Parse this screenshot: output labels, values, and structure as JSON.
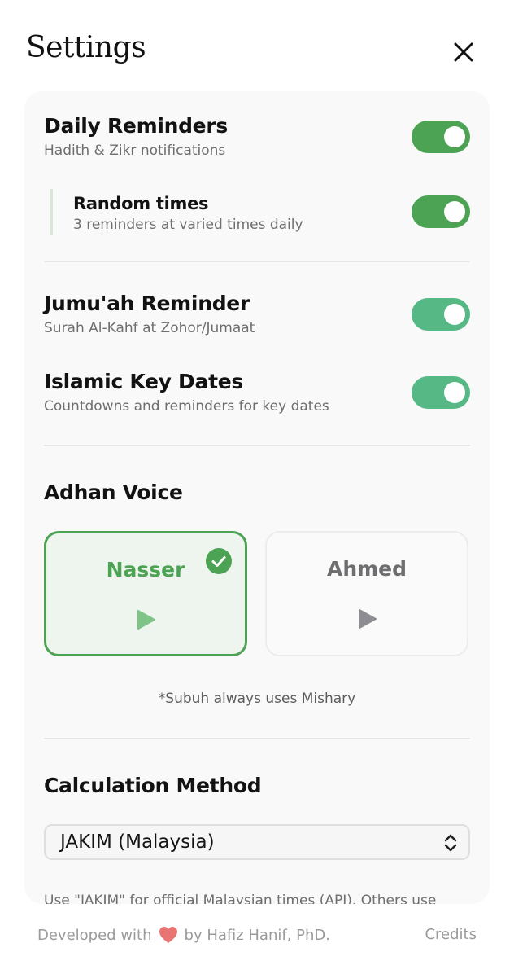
{
  "header": {
    "title": "Settings"
  },
  "reminders": {
    "daily": {
      "title": "Daily Reminders",
      "subtitle": "Hadith & Zikr notifications",
      "enabled": true
    },
    "random": {
      "title": "Random times",
      "subtitle": "3 reminders at varied times daily",
      "enabled": true
    },
    "jumuah": {
      "title": "Jumu'ah Reminder",
      "subtitle": "Surah Al-Kahf at Zohor/Jumaat",
      "enabled": true
    },
    "key_dates": {
      "title": "Islamic Key Dates",
      "subtitle": "Countdowns and reminders for key dates",
      "enabled": true
    }
  },
  "adhan": {
    "title": "Adhan Voice",
    "voices": [
      {
        "name": "Nasser",
        "selected": true
      },
      {
        "name": "Ahmed",
        "selected": false
      }
    ],
    "note": "*Subuh always uses Mishary"
  },
  "calculation": {
    "title": "Calculation Method",
    "selected": "JAKIM (Malaysia)",
    "help": "Use \"JAKIM\" for official Malaysian times (API). Others use"
  },
  "footer": {
    "developed_prefix": "Developed with",
    "developed_suffix": "by Hafiz Hanif, PhD.",
    "credits": "Credits"
  },
  "colors": {
    "toggle_dark_green": "#4ca353",
    "toggle_light_green": "#55b885",
    "heart": "#e87474"
  }
}
